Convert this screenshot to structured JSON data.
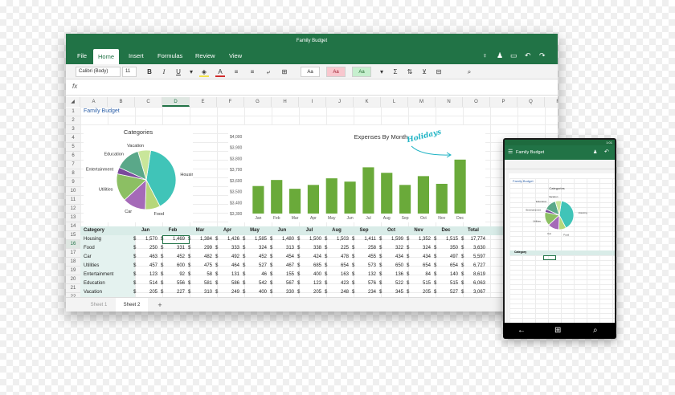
{
  "window": {
    "title": "Family Budget"
  },
  "ribbon": {
    "tabs": [
      "File",
      "Home",
      "Insert",
      "Formulas",
      "Review",
      "View"
    ],
    "active_tab": "Home"
  },
  "toolbar": {
    "font_name": "Calibri (Body)",
    "font_size": "11",
    "style_normal": "Aa",
    "style_bad": "Aa",
    "style_good": "Aa"
  },
  "formula_bar": {
    "fx_label": "fx"
  },
  "grid": {
    "columns": [
      "A",
      "B",
      "C",
      "D",
      "E",
      "F",
      "G",
      "H",
      "I",
      "J",
      "K",
      "L",
      "M",
      "N",
      "O",
      "P",
      "Q",
      "R"
    ],
    "selected_column": "D",
    "rows": [
      "1",
      "2",
      "3",
      "4",
      "5",
      "6",
      "7",
      "8",
      "9",
      "10",
      "11",
      "12",
      "13",
      "14",
      "15",
      "16",
      "17",
      "18",
      "19",
      "20",
      "21",
      "22"
    ],
    "selected_row": "16",
    "sheet_title": "Family Budget"
  },
  "table": {
    "headers": [
      "Category",
      "Jan",
      "Feb",
      "Mar",
      "Apr",
      "May",
      "Jun",
      "Jul",
      "Aug",
      "Sep",
      "Oct",
      "Nov",
      "Dec",
      "Total"
    ],
    "currency": "$",
    "rows": [
      {
        "category": "Housing",
        "values": [
          "1,570",
          "1,469",
          "1,384",
          "1,426",
          "1,585",
          "1,480",
          "1,500",
          "1,503",
          "1,411",
          "1,599",
          "1,352",
          "1,515",
          "17,774"
        ]
      },
      {
        "category": "Food",
        "values": [
          "250",
          "331",
          "299",
          "333",
          "324",
          "313",
          "338",
          "225",
          "258",
          "322",
          "324",
          "350",
          "3,630"
        ]
      },
      {
        "category": "Car",
        "values": [
          "463",
          "452",
          "482",
          "492",
          "452",
          "454",
          "424",
          "478",
          "455",
          "434",
          "434",
          "497",
          "5,597"
        ]
      },
      {
        "category": "Utilities",
        "values": [
          "457",
          "600",
          "475",
          "464",
          "527",
          "467",
          "685",
          "654",
          "573",
          "650",
          "654",
          "654",
          "6,727"
        ]
      },
      {
        "category": "Entertainment",
        "values": [
          "123",
          "92",
          "58",
          "131",
          "46",
          "155",
          "400",
          "163",
          "132",
          "136",
          "84",
          "140",
          "8,619"
        ]
      },
      {
        "category": "Education",
        "values": [
          "514",
          "556",
          "581",
          "586",
          "542",
          "567",
          "123",
          "423",
          "576",
          "522",
          "515",
          "515",
          "6,063"
        ]
      },
      {
        "category": "Vacation",
        "values": [
          "205",
          "227",
          "310",
          "249",
          "400",
          "330",
          "205",
          "248",
          "234",
          "345",
          "205",
          "527",
          "3,067"
        ]
      }
    ]
  },
  "sheets": {
    "tabs": [
      "Sheet 1",
      "Sheet 2"
    ],
    "active": "Sheet 2",
    "add_label": "+"
  },
  "chart_data": [
    {
      "type": "pie",
      "title": "Categories",
      "categories": [
        "Housing",
        "Food",
        "Car",
        "Utilities",
        "Entertainment",
        "Education",
        "Vacation"
      ],
      "values": [
        17774,
        3630,
        5597,
        6727,
        1600,
        6063,
        3067
      ],
      "colors": [
        "#40c4b8",
        "#b6d77a",
        "#a56ab8",
        "#8cbf63",
        "#7a4a9c",
        "#5aa889",
        "#c9e69a"
      ]
    },
    {
      "type": "bar",
      "title": "Expenses By Month",
      "categories": [
        "Jan",
        "Feb",
        "Mar",
        "Apr",
        "May",
        "Jun",
        "Jul",
        "Aug",
        "Sep",
        "Oct",
        "Nov",
        "Dec"
      ],
      "values": [
        3550,
        3605,
        3525,
        3560,
        3620,
        3590,
        3720,
        3670,
        3560,
        3640,
        3570,
        3790
      ],
      "ylim": [
        3300,
        4000
      ],
      "yticks": [
        "$4,000",
        "$3,900",
        "$3,800",
        "$3,700",
        "$3,600",
        "$3,500",
        "$3,400",
        "$3,300"
      ],
      "color": "#6aaa3a",
      "annotation": "Holidays"
    }
  ],
  "phone": {
    "status_time": "1:01",
    "title": "Family Budget",
    "sheet_title": "Category",
    "chart_title": "Categories"
  }
}
